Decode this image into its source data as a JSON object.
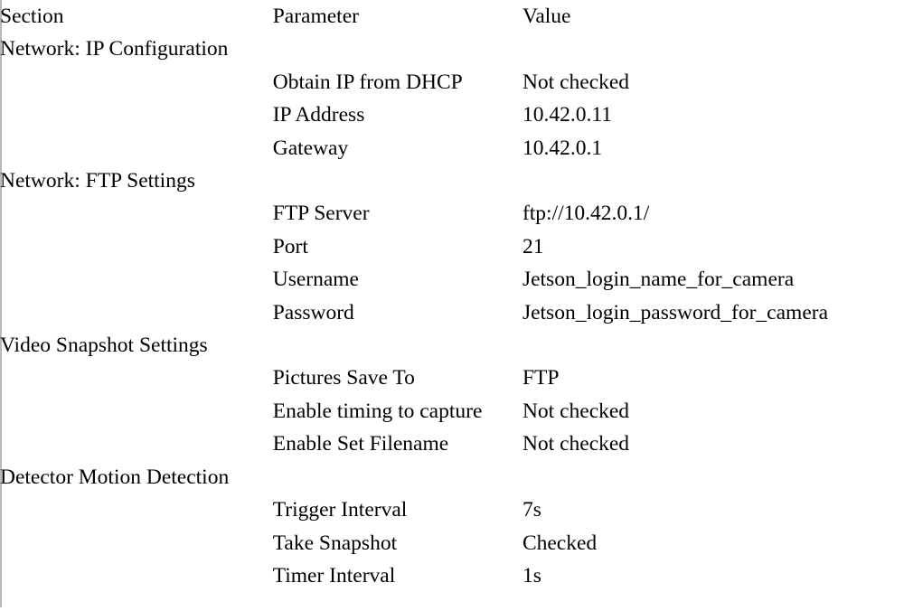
{
  "table": {
    "headers": {
      "section": "Section",
      "parameter": "Parameter",
      "value": "Value"
    },
    "rows": [
      {
        "kind": "section",
        "section": "Network: IP Configuration",
        "parameter": "",
        "value": ""
      },
      {
        "kind": "param",
        "section": "",
        "parameter": "Obtain IP from DHCP",
        "value": "Not checked"
      },
      {
        "kind": "param",
        "section": "",
        "parameter": "IP Address",
        "value": "10.42.0.11"
      },
      {
        "kind": "param",
        "section": "",
        "parameter": "Gateway",
        "value": "10.42.0.1"
      },
      {
        "kind": "section",
        "section": "Network: FTP Settings",
        "parameter": "",
        "value": ""
      },
      {
        "kind": "param",
        "section": "",
        "parameter": "FTP Server",
        "value": "ftp://10.42.0.1/"
      },
      {
        "kind": "param",
        "section": "",
        "parameter": "Port",
        "value": "21"
      },
      {
        "kind": "param",
        "section": "",
        "parameter": "Username",
        "value": "Jetson_login_name_for_camera"
      },
      {
        "kind": "param",
        "section": "",
        "parameter": "Password",
        "value": "Jetson_login_password_for_camera"
      },
      {
        "kind": "section",
        "section": "Video Snapshot Settings",
        "parameter": "",
        "value": ""
      },
      {
        "kind": "param",
        "section": "",
        "parameter": "Pictures Save To",
        "value": "FTP"
      },
      {
        "kind": "param",
        "section": "",
        "parameter": "Enable timing to capture",
        "value": "Not checked"
      },
      {
        "kind": "param",
        "section": "",
        "parameter": "Enable Set Filename",
        "value": "Not checked"
      },
      {
        "kind": "section",
        "section": "Detector Motion Detection",
        "parameter": "",
        "value": ""
      },
      {
        "kind": "param",
        "section": "",
        "parameter": "Trigger Interval",
        "value": "7s"
      },
      {
        "kind": "param",
        "section": "",
        "parameter": "Take Snapshot",
        "value": "Checked"
      },
      {
        "kind": "param",
        "section": "",
        "parameter": "Timer Interval",
        "value": "1s"
      }
    ]
  },
  "style": {
    "text_color": "#000000",
    "background_color": "#ffffff",
    "edge_rule_color": "#b9b9b9"
  }
}
